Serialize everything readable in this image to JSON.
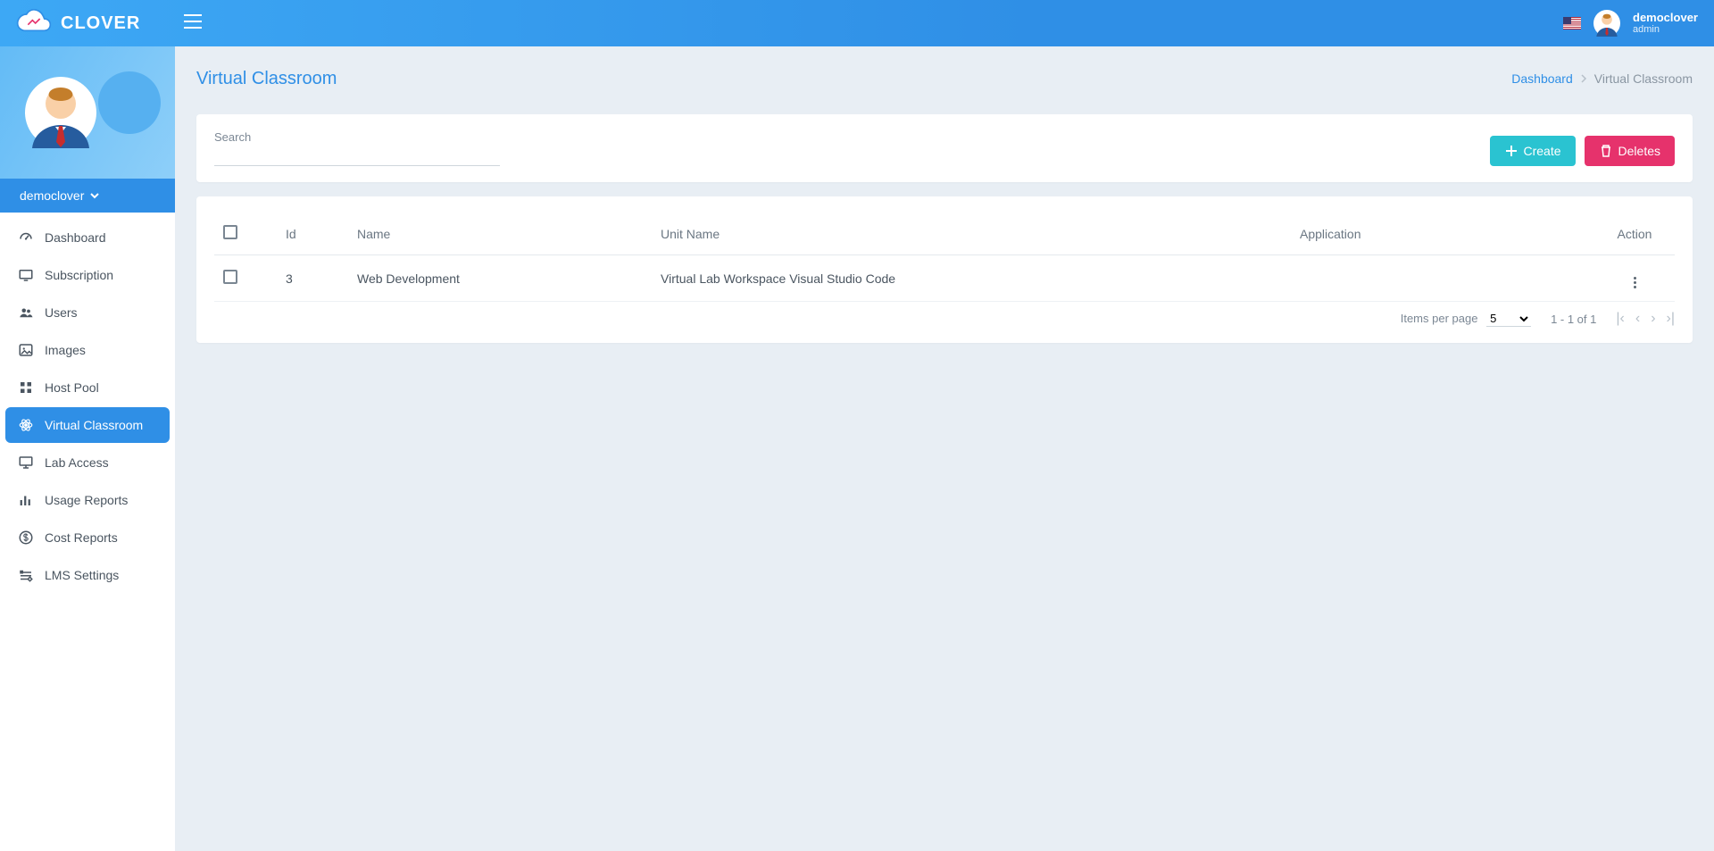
{
  "brand": "CLOVER",
  "user": {
    "name": "democlover",
    "role": "admin"
  },
  "sidebar": {
    "user": "democlover",
    "items": [
      {
        "label": "Dashboard"
      },
      {
        "label": "Subscription"
      },
      {
        "label": "Users"
      },
      {
        "label": "Images"
      },
      {
        "label": "Host Pool"
      },
      {
        "label": "Virtual Classroom"
      },
      {
        "label": "Lab Access"
      },
      {
        "label": "Usage Reports"
      },
      {
        "label": "Cost Reports"
      },
      {
        "label": "LMS Settings"
      }
    ]
  },
  "page": {
    "title": "Virtual Classroom",
    "breadcrumb_root": "Dashboard",
    "breadcrumb_current": "Virtual Classroom"
  },
  "toolbar": {
    "search_label": "Search",
    "create_label": "Create",
    "delete_label": "Deletes"
  },
  "table": {
    "headers": {
      "id": "Id",
      "name": "Name",
      "unit": "Unit Name",
      "app": "Application",
      "action": "Action"
    },
    "rows": [
      {
        "id": "3",
        "name": "Web Development",
        "unit": "Virtual Lab Workspace Visual Studio Code",
        "app": ""
      }
    ]
  },
  "pager": {
    "items_label": "Items per page",
    "size": "5",
    "range": "1 - 1 of 1"
  }
}
